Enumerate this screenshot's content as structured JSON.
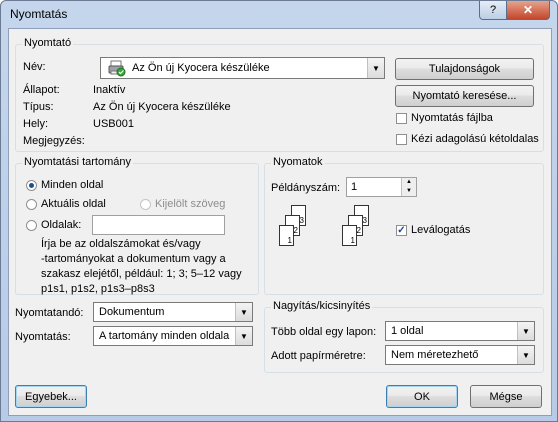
{
  "window": {
    "title": "Nyomtatás",
    "help_label": "?",
    "close_label": "✕"
  },
  "printer": {
    "legend": "Nyomtató",
    "name_label": "Név:",
    "name_value": "Az Ön új Kyocera készüléke",
    "status_label": "Állapot:",
    "status_value": "Inaktív",
    "type_label": "Típus:",
    "type_value": "Az Ön új Kyocera készüléke",
    "where_label": "Hely:",
    "where_value": "USB001",
    "comment_label": "Megjegyzés:",
    "properties_button": "Tulajdonságok",
    "find_printer_button": "Nyomtató keresése...",
    "print_to_file_label": "Nyomtatás fájlba",
    "print_to_file_checked": false,
    "manual_duplex_label": "Kézi adagolású kétoldalas",
    "manual_duplex_checked": false
  },
  "range": {
    "legend": "Nyomtatási tartomány",
    "all_label": "Minden oldal",
    "current_label": "Aktuális oldal",
    "selection_label": "Kijelölt szöveg",
    "pages_label": "Oldalak:",
    "pages_value": "",
    "selected": "all",
    "hint": "Írja be az oldalszámokat és/vagy\n-tartományokat a dokumentum vagy a\nszakasz elejétől, például: 1; 3; 5–12 vagy\np1s1, p1s2, p1s3–p8s3"
  },
  "copies": {
    "legend": "Nyomatok",
    "count_label": "Példányszám:",
    "count_value": "1",
    "collate_label": "Leválogatás",
    "collate_checked": true,
    "collated_pages": [
      "1",
      "2",
      "3",
      "1",
      "2",
      "3"
    ]
  },
  "print_what": {
    "label": "Nyomtatandó:",
    "value": "Dokumentum"
  },
  "print": {
    "label": "Nyomtatás:",
    "value": "A tartomány minden oldala"
  },
  "zoom": {
    "legend": "Nagyítás/kicsinyítés",
    "pages_per_sheet_label": "Több oldal egy lapon:",
    "pages_per_sheet_value": "1 oldal",
    "scale_label": "Adott papírméretre:",
    "scale_value": "Nem méretezhető"
  },
  "footer": {
    "options_button": "Egyebek...",
    "ok_button": "OK",
    "cancel_button": "Mégse"
  }
}
